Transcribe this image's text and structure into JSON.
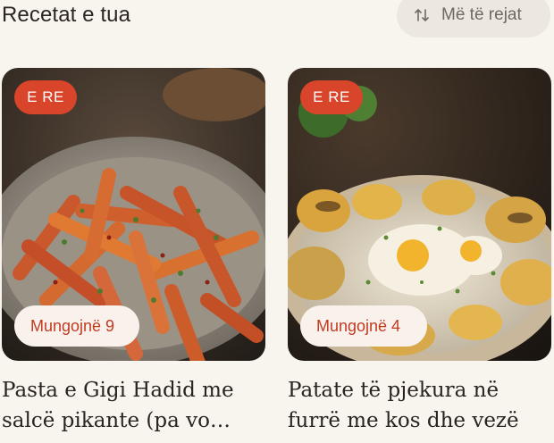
{
  "header": {
    "title": "Recetat e tua",
    "sort_label": "Më të rejat"
  },
  "recipes": [
    {
      "badge": "E RE",
      "missing": "Mungojnë 9",
      "title": "Pasta e Gigi Hadid me salcë pikante (pa vo…"
    },
    {
      "badge": "E RE",
      "missing": "Mungojnë 4",
      "title": "Patate të pjekura në furrë me kos dhe vezë"
    }
  ],
  "colors": {
    "background": "#f8f4ee",
    "accent": "#d9452a",
    "missing_text": "#c23a22"
  }
}
